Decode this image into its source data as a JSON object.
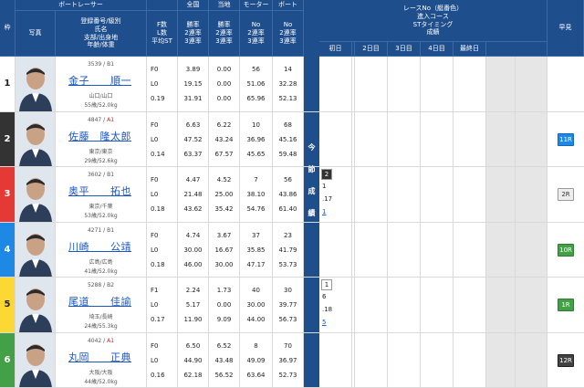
{
  "header": {
    "waku": "枠",
    "photo": "写真",
    "boat_racer": "ボートレーサー",
    "racer_info": [
      "登録番号/級別",
      "氏名",
      "支部/出身地",
      "年齢/体重"
    ],
    "f_l_st": [
      "F数",
      "L数",
      "平均ST"
    ],
    "national": "全国",
    "local": "当地",
    "motor": "モーター",
    "boat": "ボート",
    "national_sub": [
      "勝率",
      "2連率",
      "3連率"
    ],
    "local_sub": [
      "勝率",
      "2連率",
      "3連率"
    ],
    "motor_sub": [
      "No",
      "2連率",
      "3連率"
    ],
    "boat_sub": [
      "No",
      "2連率",
      "3連率"
    ],
    "race_title": [
      "レースNo（艇番色）",
      "進入コース",
      "STタイミング",
      "成績"
    ],
    "days": [
      "初日",
      "2日目",
      "3日目",
      "4日目",
      "最終日"
    ],
    "early": "早見"
  },
  "konsetsu": [
    "今",
    "節",
    "成",
    "績"
  ],
  "colors": {
    "header_bg": "#1f4e8c",
    "link": "#1a56c4",
    "waku": [
      "#ffffff",
      "#333333",
      "#e53935",
      "#1e88e5",
      "#fdd835",
      "#43a047"
    ],
    "waku_text": [
      "#222222",
      "#ffffff",
      "#ffffff",
      "#ffffff",
      "#222222",
      "#ffffff"
    ]
  },
  "racers": [
    {
      "waku": "1",
      "reg": "3539",
      "cls": "B1",
      "name": "金子　　順一",
      "branch": "山口/山口",
      "age": "55歳/52.0kg",
      "f": "F0",
      "l": "L0",
      "st": "0.19",
      "nat": [
        "3.89",
        "19.15",
        "31.91"
      ],
      "loc": [
        "0.00",
        "0.00",
        "0.00"
      ],
      "mot": [
        "56",
        "51.06",
        "65.96"
      ],
      "boa": [
        "14",
        "32.28",
        "52.13"
      ],
      "race": null,
      "early": "",
      "early_style": "none"
    },
    {
      "waku": "2",
      "reg": "4847",
      "cls": "A1",
      "name": "佐藤　隆太郎",
      "branch": "東京/東京",
      "age": "29歳/52.6kg",
      "f": "F0",
      "l": "L0",
      "st": "0.14",
      "nat": [
        "6.63",
        "47.52",
        "63.37"
      ],
      "loc": [
        "6.22",
        "43.24",
        "67.57"
      ],
      "mot": [
        "10",
        "36.96",
        "45.65"
      ],
      "boa": [
        "68",
        "45.16",
        "59.48"
      ],
      "race": null,
      "early": "11R",
      "early_style": "blue"
    },
    {
      "waku": "3",
      "reg": "3602",
      "cls": "B1",
      "name": "奥平　　拓也",
      "branch": "東京/千葉",
      "age": "53歳/52.0kg",
      "f": "F0",
      "l": "L0",
      "st": "0.18",
      "nat": [
        "4.47",
        "21.48",
        "43.62"
      ],
      "loc": [
        "4.52",
        "25.00",
        "35.42"
      ],
      "mot": [
        "7",
        "38.10",
        "54.76"
      ],
      "boa": [
        "56",
        "43.86",
        "61.40"
      ],
      "race": {
        "r": "2",
        "c": "1",
        "st": ".17",
        "res": "1"
      },
      "early": "2R",
      "early_style": "gray"
    },
    {
      "waku": "4",
      "reg": "4271",
      "cls": "B1",
      "name": "川崎　　公靖",
      "branch": "広島/広島",
      "age": "41歳/52.0kg",
      "f": "F0",
      "l": "L0",
      "st": "0.18",
      "nat": [
        "4.74",
        "30.00",
        "46.00"
      ],
      "loc": [
        "3.67",
        "16.67",
        "30.00"
      ],
      "mot": [
        "37",
        "35.85",
        "47.17"
      ],
      "boa": [
        "23",
        "41.79",
        "53.73"
      ],
      "race": null,
      "early": "10R",
      "early_style": "green"
    },
    {
      "waku": "5",
      "reg": "5288",
      "cls": "B2",
      "name": "尾道　　佳諭",
      "branch": "埼玉/長崎",
      "age": "24歳/55.3kg",
      "f": "F1",
      "l": "L0",
      "st": "0.17",
      "nat": [
        "2.24",
        "5.17",
        "11.90"
      ],
      "loc": [
        "1.73",
        "0.00",
        "9.09"
      ],
      "mot": [
        "40",
        "30.00",
        "44.00"
      ],
      "boa": [
        "30",
        "39.77",
        "56.73"
      ],
      "race": {
        "r": "1",
        "c": "6",
        "st": ".18",
        "res": "5"
      },
      "early": "1R",
      "early_style": "green"
    },
    {
      "waku": "6",
      "reg": "4042",
      "cls": "A1",
      "name": "丸岡　　正典",
      "branch": "大阪/大阪",
      "age": "44歳/52.0kg",
      "f": "F0",
      "l": "L0",
      "st": "0.16",
      "nat": [
        "6.50",
        "44.90",
        "62.18"
      ],
      "loc": [
        "6.52",
        "43.48",
        "56.52"
      ],
      "mot": [
        "8",
        "49.09",
        "63.64"
      ],
      "boa": [
        "70",
        "36.97",
        "52.73"
      ],
      "race": null,
      "early": "12R",
      "early_style": "dark"
    }
  ]
}
